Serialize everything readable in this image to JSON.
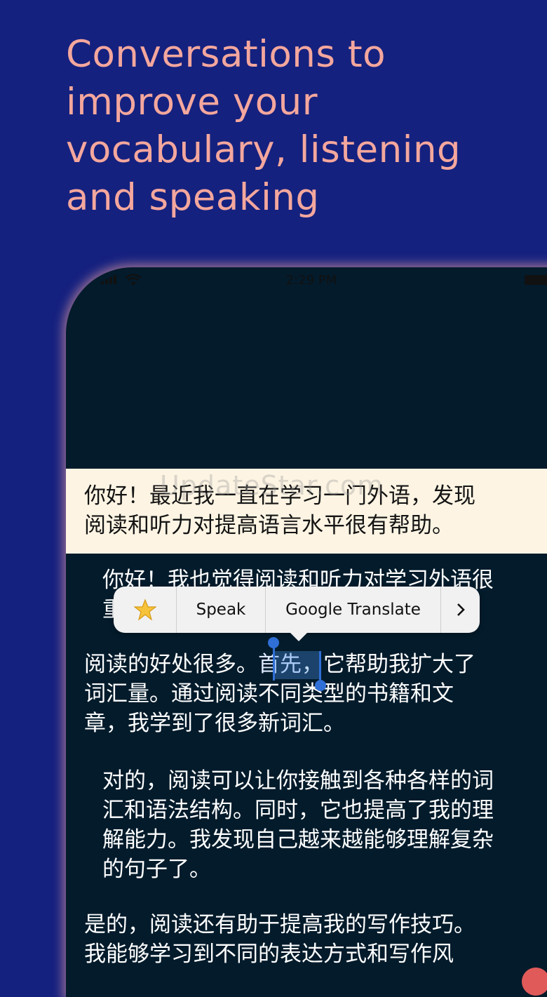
{
  "headline": {
    "lines": [
      "Conversations to",
      "improve your",
      "vocabulary, listening",
      "and speaking"
    ]
  },
  "status_bar": {
    "time": "2:29 PM"
  },
  "watermark": "UpdateStar.com",
  "conversation": {
    "message_1": {
      "line1": "你好！最近我一直在学习一门外语，发现",
      "line2": "阅读和听力对提高语言水平很有帮助。"
    },
    "message_2": {
      "line1": "你好！我也觉得阅读和听力对学习外语很",
      "line2_start": "重"
    },
    "message_3": {
      "line1_prefix": "阅读的好处很多。",
      "line1_selected": "首先",
      "line1_suffix": "，它帮助我扩大了",
      "line2": "词汇量。通过阅读不同类型的书籍和文",
      "line3": "章，我学到了很多新词汇。"
    },
    "message_4": {
      "line1": "对的，阅读可以让你接触到各种各样的词",
      "line2": "汇和语法结构。同时，它也提高了我的理",
      "line3": "解能力。我发现自己越来越能够理解复杂",
      "line4": "的句子了。"
    },
    "message_5": {
      "line1": "是的，阅读还有助于提高我的写作技巧。",
      "line2": "我能够学习到不同的表达方式和写作风"
    }
  },
  "context_menu": {
    "favorite_icon": "star-icon",
    "speak_label": "Speak",
    "translate_label": "Google Translate",
    "more_icon": "chevron-right-icon"
  },
  "colors": {
    "background": "#15217f",
    "headline": "#f4a79d",
    "screen": "#031b2b",
    "highlight_bubble": "#fdf4e3",
    "selection": "#2f6fd6"
  }
}
